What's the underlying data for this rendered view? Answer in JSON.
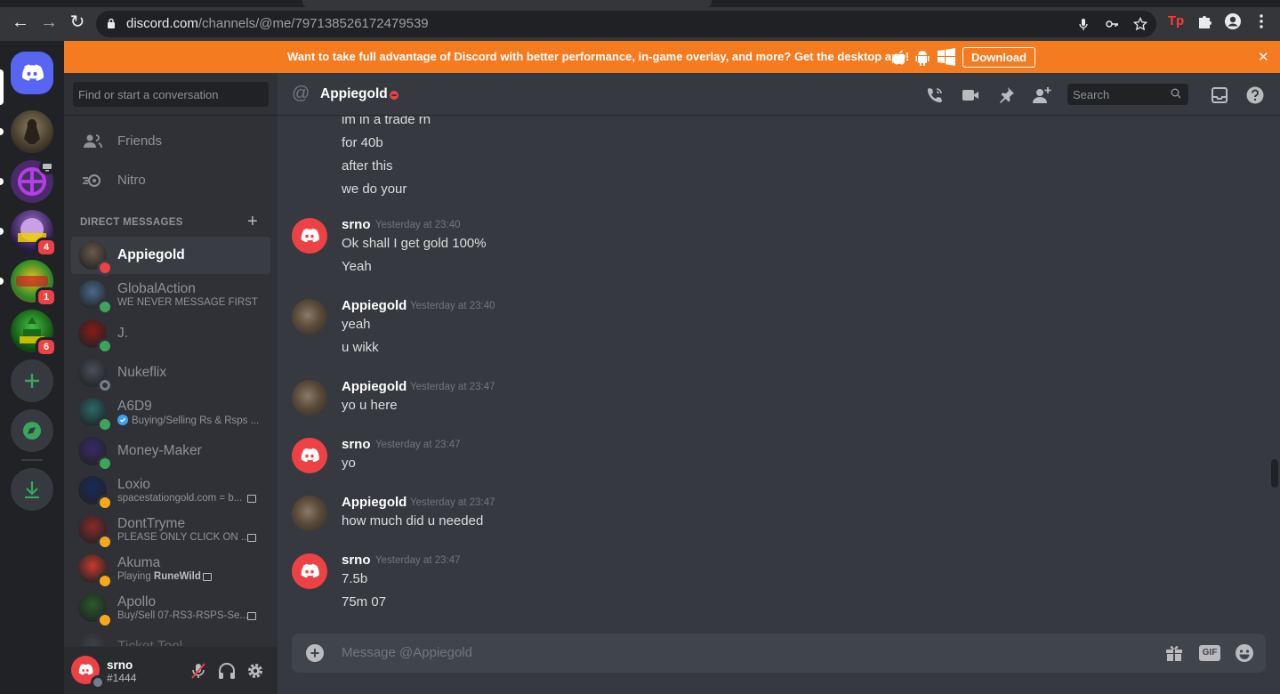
{
  "browser": {
    "url_host": "discord.com",
    "url_path": "/channels/@me/797138526172479539",
    "back_glyph": "←",
    "forward_glyph": "→",
    "reload_glyph": "↻",
    "ext_label": "Tp"
  },
  "banner": {
    "message": "Want to take full advantage of Discord with better performance, in-game overlay, and more? Get the desktop app!",
    "download_label": "Download",
    "close_glyph": "✕"
  },
  "guild_badges": [
    "4",
    "1",
    "6"
  ],
  "sidebar": {
    "search_placeholder": "Find or start a conversation",
    "nav": [
      {
        "label": "Friends",
        "icon": "friends-icon"
      },
      {
        "label": "Nitro",
        "icon": "nitro-icon"
      }
    ],
    "dm_header": "DIRECT MESSAGES",
    "dms": [
      {
        "name": "Appiegold",
        "sub": "",
        "status": "dnd",
        "color": "#6b5a4a"
      },
      {
        "name": "GlobalAction",
        "sub": "WE NEVER MESSAGE FIRST",
        "status": "online",
        "color": "#4a6a8a"
      },
      {
        "name": "J.",
        "sub": "",
        "status": "online",
        "color": "#8a1a1a"
      },
      {
        "name": "Nukeflix",
        "sub": "",
        "status": "offline",
        "color": "#4a4f5a"
      },
      {
        "name": "A6D9",
        "sub": "Buying/Selling Rs & Rsps ...",
        "status": "online",
        "color": "#2a6a6a"
      },
      {
        "name": "Money-Maker",
        "sub": "",
        "status": "online",
        "color": "#3a2a6a"
      },
      {
        "name": "Loxio",
        "sub": "spacestationgold.com = b...",
        "status": "idle",
        "color": "#1a2a5a"
      },
      {
        "name": "DontTryme",
        "sub": "PLEASE ONLY CLICK ON ...",
        "status": "idle",
        "color": "#8a2a2a"
      },
      {
        "name": "Akuma",
        "sub_prefix": "Playing ",
        "sub_bold": "RuneWild",
        "status": "idle",
        "color": "#c83a2a"
      },
      {
        "name": "Apollo",
        "sub": "Buy/Sell 07-RS3-RSPS-Se...",
        "status": "idle",
        "color": "#2a5a2a"
      },
      {
        "name": "Ticket Tool",
        "sub": "",
        "status": "none",
        "color": "#4a4f5a"
      }
    ]
  },
  "user": {
    "name": "srno",
    "tag": "#1444"
  },
  "chat": {
    "title": "Appiegold",
    "search_placeholder": "Search",
    "composer_placeholder": "Message @Appiegold",
    "gif_label": "GIF",
    "top_lines": [
      "im in a trade rn",
      "for 40b",
      "after this",
      "we do your"
    ],
    "messages": [
      {
        "author": "srno",
        "time": "Yesterday at 23:40",
        "lines": [
          "Ok shall I get gold 100%",
          "Yeah"
        ],
        "avatar": "discord"
      },
      {
        "author": "Appiegold",
        "time": "Yesterday at 23:40",
        "lines": [
          "yeah",
          "u wikk"
        ],
        "avatar": "photo"
      },
      {
        "author": "Appiegold",
        "time": "Yesterday at 23:47",
        "lines": [
          "yo u here"
        ],
        "avatar": "photo"
      },
      {
        "author": "srno",
        "time": "Yesterday at 23:47",
        "lines": [
          "yo"
        ],
        "avatar": "discord"
      },
      {
        "author": "Appiegold",
        "time": "Yesterday at 23:47",
        "lines": [
          "how much did u needed"
        ],
        "avatar": "photo"
      },
      {
        "author": "srno",
        "time": "Yesterday at 23:47",
        "lines": [
          "7.5b",
          "75m 07"
        ],
        "avatar": "discord"
      }
    ]
  },
  "colors": {
    "brand": "#5865f2",
    "banner": "#f47b20",
    "dnd": "#ed4245",
    "online": "#3ba55d",
    "idle": "#faa81a"
  }
}
